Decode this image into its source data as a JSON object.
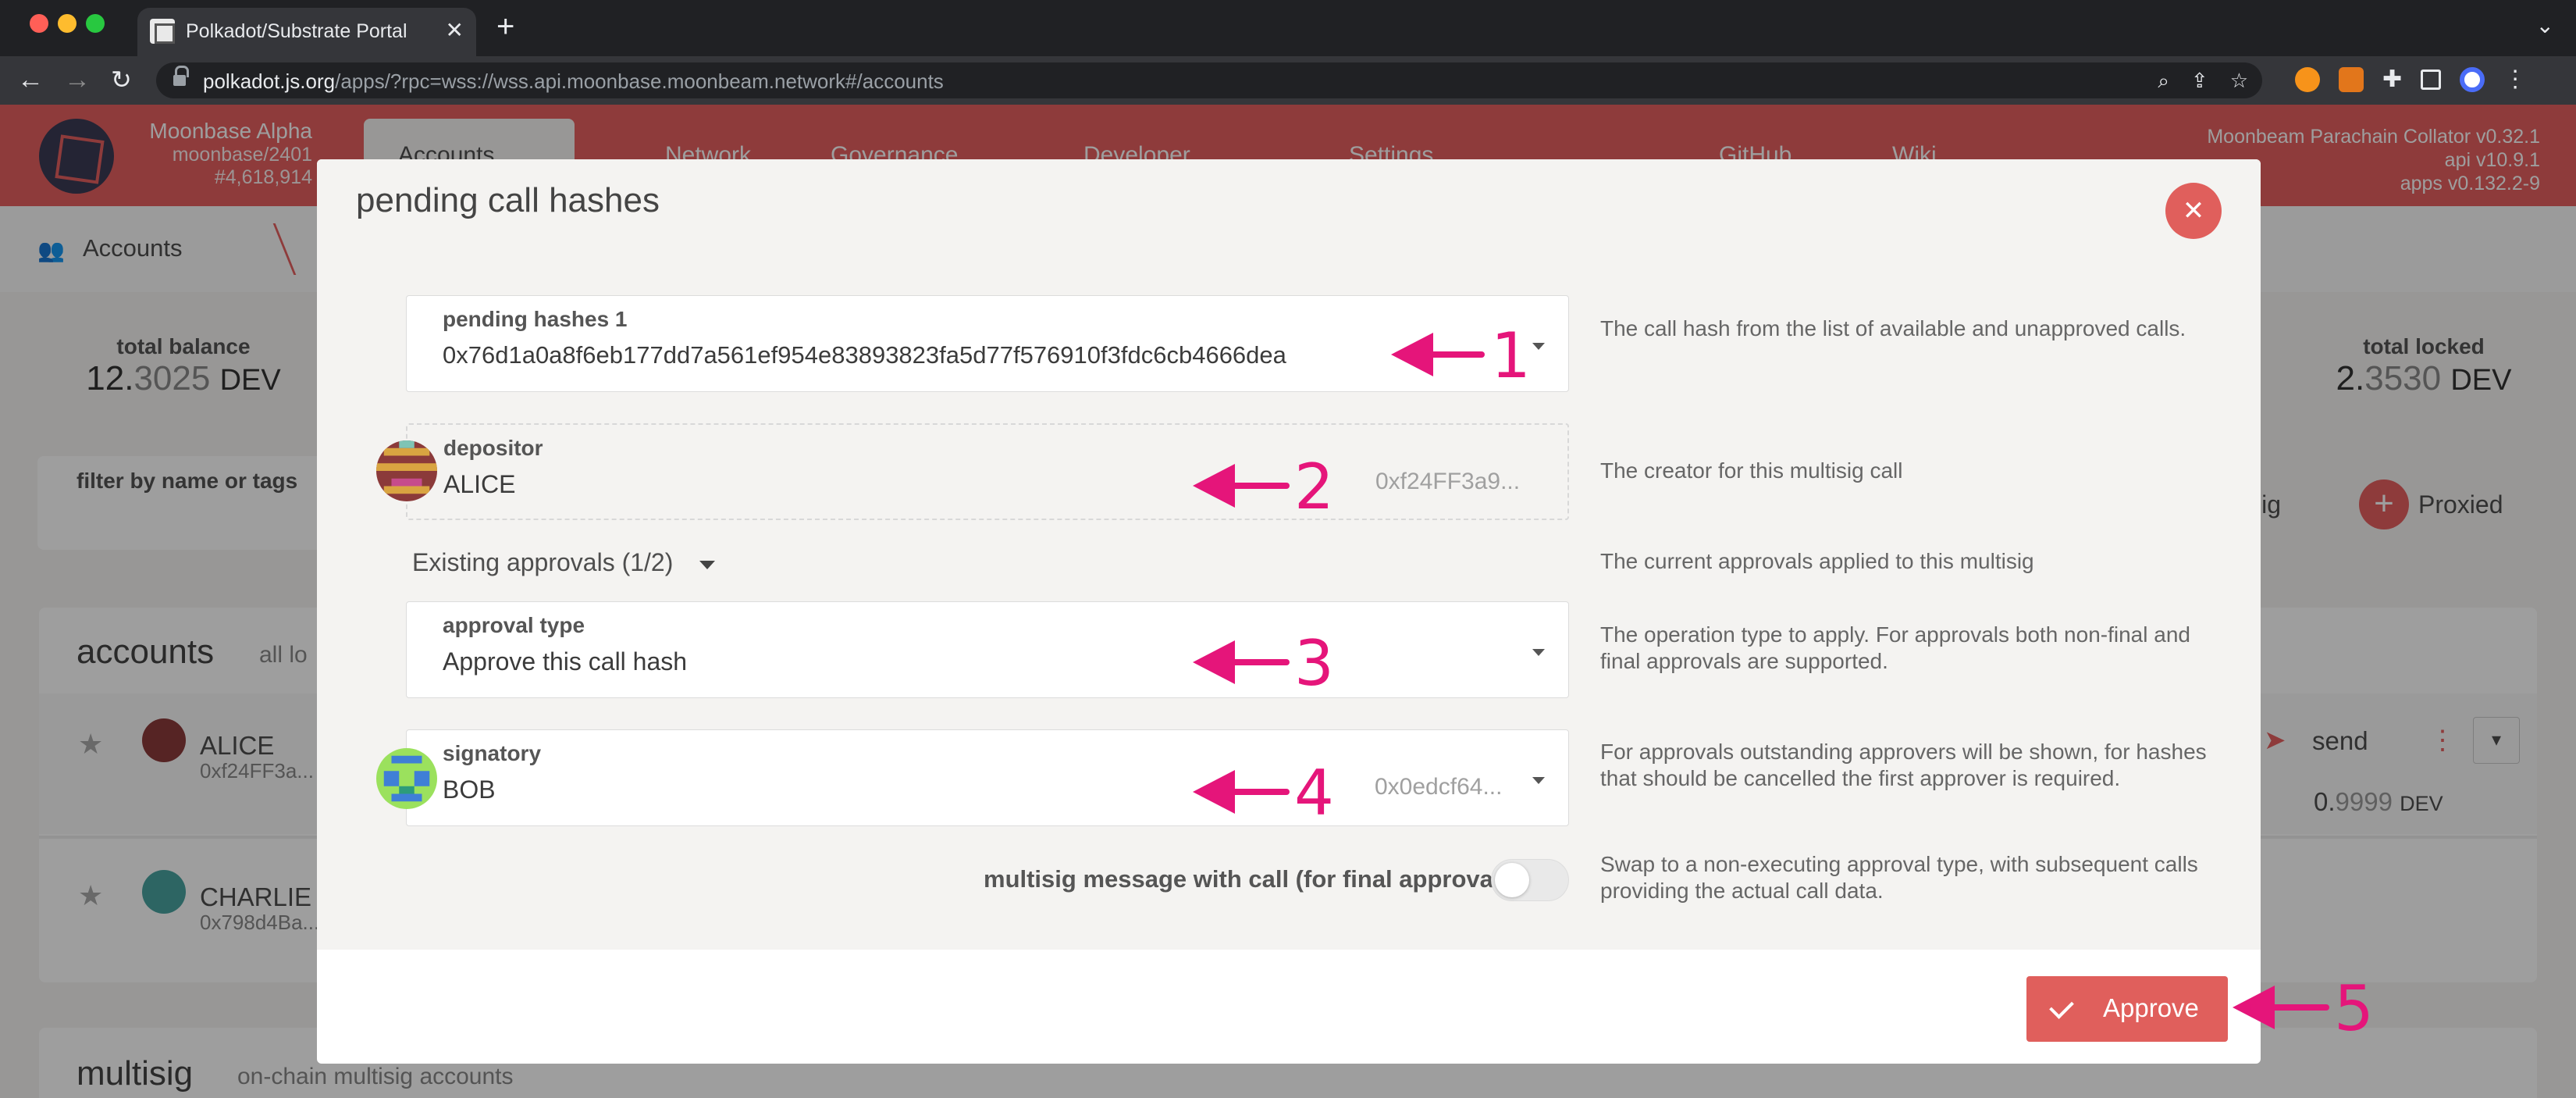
{
  "browser": {
    "tab_title": "Polkadot/Substrate Portal",
    "url_host": "polkadot.js.org",
    "url_path": "/apps/?rpc=wss://wss.api.moonbase.moonbeam.network#/accounts",
    "traffic_colors": [
      "#ff5f57",
      "#febc2e",
      "#28c840"
    ]
  },
  "app": {
    "chain_name": "Moonbase Alpha",
    "chain_runtime": "moonbase/2401",
    "chain_block": "#4,618,914",
    "menu": [
      "Accounts",
      "Network",
      "Governance",
      "Developer",
      "Settings",
      "GitHub",
      "Wiki"
    ],
    "version_lines": [
      "Moonbeam Parachain Collator v0.32.1",
      "api v10.9.1",
      "apps v0.132.2-9"
    ],
    "subnav_label": "Accounts",
    "total_balance_label": "total balance",
    "total_balance_int": "12.",
    "total_balance_dec": "3025",
    "total_balance_unit": "DEV",
    "total_locked_label": "total locked",
    "total_locked_int": "2.",
    "total_locked_dec": "3530",
    "total_locked_unit": "DEV",
    "filter_label": "filter by name or tags",
    "multisig_btn_partial": "isig",
    "proxied_label": "Proxied",
    "accounts_title": "accounts",
    "accounts_sub": "all lo",
    "rows": [
      {
        "name": "ALICE",
        "addr": "0xf24FF3a..."
      },
      {
        "name": "CHARLIE",
        "addr": "0x798d4Ba..."
      }
    ],
    "send_label": "send",
    "row_balance_int": "0.",
    "row_balance_dec": "9999",
    "row_balance_unit": "DEV",
    "multisig_title": "multisig",
    "multisig_sub": "on-chain multisig accounts",
    "accent": "#e6605f"
  },
  "modal": {
    "title": "pending call hashes",
    "pending": {
      "label": "pending hashes 1",
      "value": "0x76d1a0a8f6eb177dd7a561ef954e83893823fa5d77f576910f3fdc6cb4666dea",
      "help": "The call hash from the list of available and unapproved calls."
    },
    "depositor": {
      "label": "depositor",
      "name": "ALICE",
      "addr": "0xf24FF3a9...",
      "help": "The creator for this multisig call"
    },
    "approvals": {
      "label": "Existing approvals (1/2)",
      "help": "The current approvals applied to this multisig"
    },
    "approval_type": {
      "label": "approval type",
      "value": "Approve this call hash",
      "help": "The operation type to apply. For approvals both non-final and final approvals are supported."
    },
    "signatory": {
      "label": "signatory",
      "name": "BOB",
      "addr": "0x0edcf64...",
      "help": "For approvals outstanding approvers will be shown, for hashes that should be cancelled the first approver is required."
    },
    "multisig_call": {
      "label": "multisig message with call (for final approval)",
      "enabled": false,
      "help": "Swap to a non-executing approval type, with subsequent calls providing the actual call data."
    },
    "approve_label": "Approve"
  },
  "annotations": [
    "1",
    "2",
    "3",
    "4",
    "5"
  ],
  "annotation_color": "#e5157a"
}
